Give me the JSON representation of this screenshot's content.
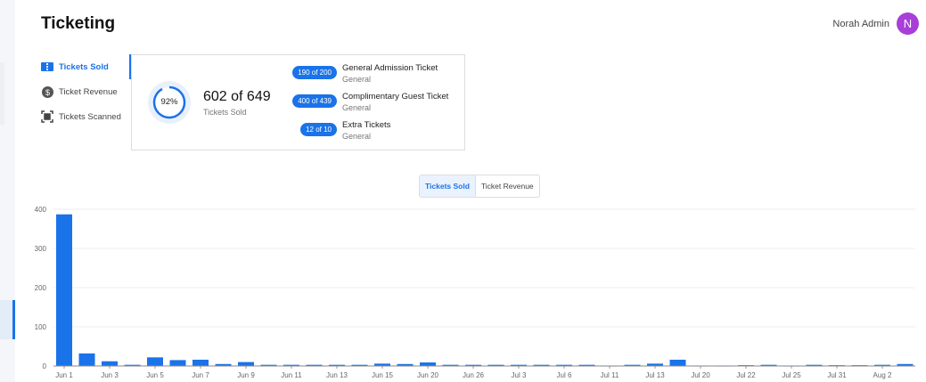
{
  "header": {
    "title": "Ticketing",
    "user_name": "Norah Admin",
    "avatar_initial": "N",
    "avatar_color": "#a73fd8"
  },
  "tabs": [
    {
      "label": "Tickets Sold",
      "icon": "ticket-icon",
      "active": true
    },
    {
      "label": "Ticket Revenue",
      "icon": "dollar-icon",
      "active": false
    },
    {
      "label": "Tickets Scanned",
      "icon": "scan-icon",
      "active": false
    }
  ],
  "summary": {
    "percent": "92%",
    "percent_value": 92,
    "total": "602 of 649",
    "total_label": "Tickets Sold",
    "tickets": [
      {
        "count": "190 of 200",
        "name": "General Admission Ticket",
        "category": "General"
      },
      {
        "count": "400 of 439",
        "name": "Complimentary Guest Ticket",
        "category": "General"
      },
      {
        "count": "12 of 10",
        "name": "Extra Tickets",
        "category": "General"
      }
    ]
  },
  "toggle": {
    "options": [
      "Tickets Sold",
      "Ticket Revenue"
    ],
    "selected": "Tickets Sold"
  },
  "accent": "#1a73e8",
  "chart_data": {
    "type": "bar",
    "ylim": [
      0,
      400
    ],
    "yticks": [
      0,
      100,
      200,
      300,
      400
    ],
    "grid": true,
    "categories": [
      "Jun 1",
      "",
      "Jun 3",
      "",
      "Jun 5",
      "",
      "Jun 7",
      "",
      "Jun 9",
      "",
      "Jun 11",
      "",
      "Jun 13",
      "",
      "Jun 15",
      "",
      "Jun 20",
      "",
      "Jun 26",
      "",
      "Jul 3",
      "",
      "Jul 6",
      "",
      "Jul 11",
      "",
      "Jul 13",
      "",
      "Jul 20",
      "",
      "Jul 22",
      "",
      "Jul 25",
      "",
      "Jul 31",
      "",
      "Aug 2",
      ""
    ],
    "values": [
      387,
      32,
      12,
      3,
      22,
      15,
      16,
      5,
      10,
      3,
      3,
      3,
      3,
      3,
      6,
      5,
      9,
      3,
      3,
      3,
      3,
      3,
      3,
      3,
      1,
      3,
      6,
      16,
      1,
      1,
      2,
      3,
      1,
      3,
      2,
      2,
      3,
      5
    ],
    "color": "#1a73e8"
  }
}
